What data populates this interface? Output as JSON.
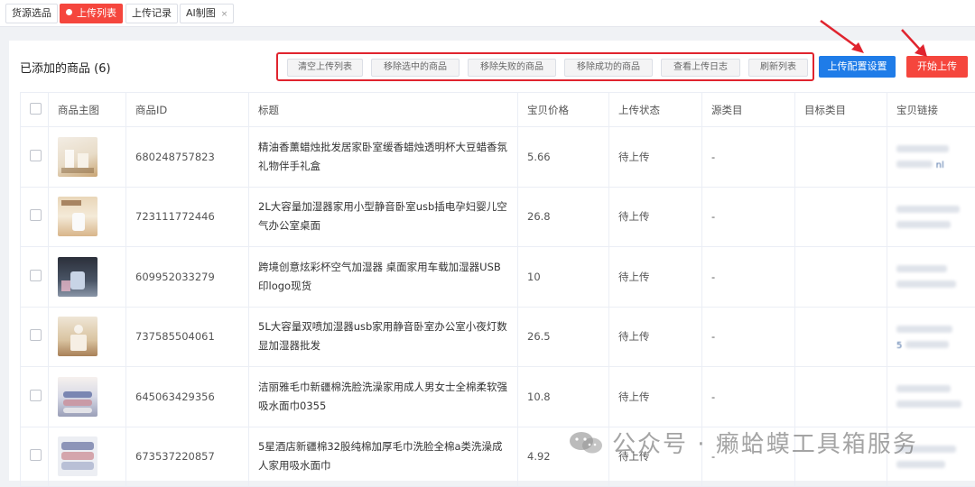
{
  "tabs": [
    {
      "label": "货源选品",
      "active": false
    },
    {
      "label": "上传列表",
      "active": true
    },
    {
      "label": "上传记录",
      "active": false
    },
    {
      "label": "AI制图",
      "active": false,
      "close": "×"
    }
  ],
  "header": {
    "title": "已添加的商品 (6)"
  },
  "toolbar": {
    "clear_list": "清空上传列表",
    "remove_selected": "移除选中的商品",
    "remove_failed": "移除失败的商品",
    "remove_success": "移除成功的商品",
    "view_log": "查看上传日志",
    "refresh_list": "刷新列表",
    "upload_config": "上传配置设置",
    "start_upload": "开始上传"
  },
  "colors": {
    "accent_red": "#f5463d",
    "primary_blue": "#1f7ce8",
    "highlight_border": "#e0242e"
  },
  "table": {
    "columns": [
      "商品主图",
      "商品ID",
      "标题",
      "宝贝价格",
      "上传状态",
      "源类目",
      "目标类目",
      "宝贝链接"
    ],
    "rows": [
      {
        "id": "680248757823",
        "title": "精油香薰蜡烛批发居家卧室缓香蜡烛透明杯大豆蜡香氛礼物伴手礼盒",
        "price": "5.66",
        "status": "待上传",
        "source_category": "-",
        "target_category": "",
        "link_partial": "nl"
      },
      {
        "id": "723111772446",
        "title": "2L大容量加湿器家用小型静音卧室usb插电孕妇婴儿空气办公室桌面",
        "price": "26.8",
        "status": "待上传",
        "source_category": "-",
        "target_category": "",
        "link_partial": ""
      },
      {
        "id": "609952033279",
        "title": "跨境创意炫彩杯空气加湿器 桌面家用车载加湿器USB印logo现货",
        "price": "10",
        "status": "待上传",
        "source_category": "-",
        "target_category": "",
        "link_partial": ""
      },
      {
        "id": "737585504061",
        "title": "5L大容量双喷加湿器usb家用静音卧室办公室小夜灯数显加湿器批发",
        "price": "26.5",
        "status": "待上传",
        "source_category": "-",
        "target_category": "",
        "link_partial": "5"
      },
      {
        "id": "645063429356",
        "title": "洁丽雅毛巾新疆棉洗脸洗澡家用成人男女士全棉柔软强吸水面巾0355",
        "price": "10.8",
        "status": "待上传",
        "source_category": "-",
        "target_category": "",
        "link_partial": ""
      },
      {
        "id": "673537220857",
        "title": "5星酒店新疆棉32股纯棉加厚毛巾洗脸全棉a类洗澡成人家用吸水面巾",
        "price": "4.92",
        "status": "待上传",
        "source_category": "-",
        "target_category": "",
        "link_partial": ""
      }
    ]
  },
  "watermark": {
    "text": "公众号 · 癞蛤蟆工具箱服务"
  }
}
